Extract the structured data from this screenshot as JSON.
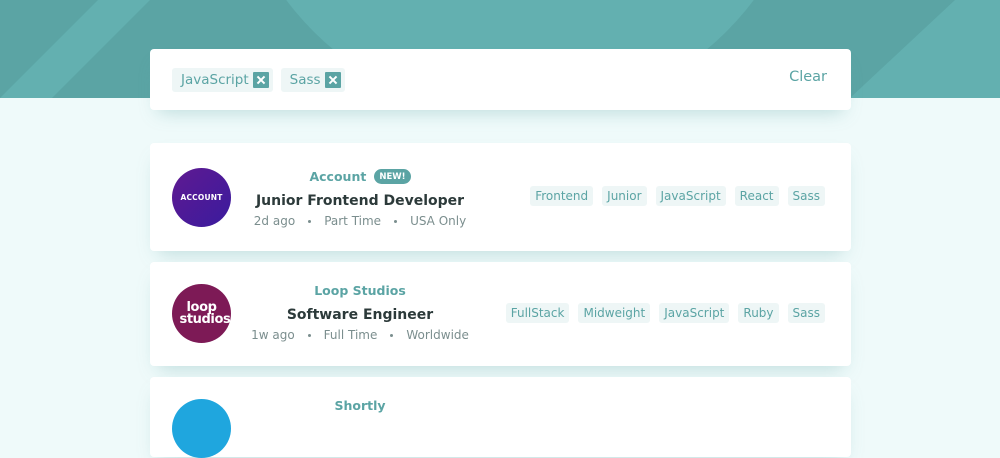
{
  "colors": {
    "primary": "#5ba4a4",
    "background": "#effafa",
    "tag_bg": "#eef6f6",
    "title_text": "#2c3a3a",
    "meta_text": "#7b8e8e"
  },
  "filter_bar": {
    "tags": [
      {
        "label": "JavaScript",
        "icon": "remove-icon"
      },
      {
        "label": "Sass",
        "icon": "remove-icon"
      }
    ],
    "clear_label": "Clear"
  },
  "jobs": [
    {
      "company": "Account",
      "badge": "NEW!",
      "logo_text": "ACCOUNT",
      "logo_color": "#5f1a91",
      "title": "Junior Frontend Developer",
      "posted": "2d ago",
      "contract": "Part Time",
      "location": "USA Only",
      "tags": [
        "Frontend",
        "Junior",
        "JavaScript",
        "React",
        "Sass"
      ]
    },
    {
      "company": "Loop Studios",
      "logo_text": "loop studios",
      "logo_color": "#7d1a56",
      "title": "Software Engineer",
      "posted": "1w ago",
      "contract": "Full Time",
      "location": "Worldwide",
      "tags": [
        "FullStack",
        "Midweight",
        "JavaScript",
        "Ruby",
        "Sass"
      ]
    },
    {
      "company": "Shortly",
      "logo_color": "#1fa6de"
    }
  ]
}
